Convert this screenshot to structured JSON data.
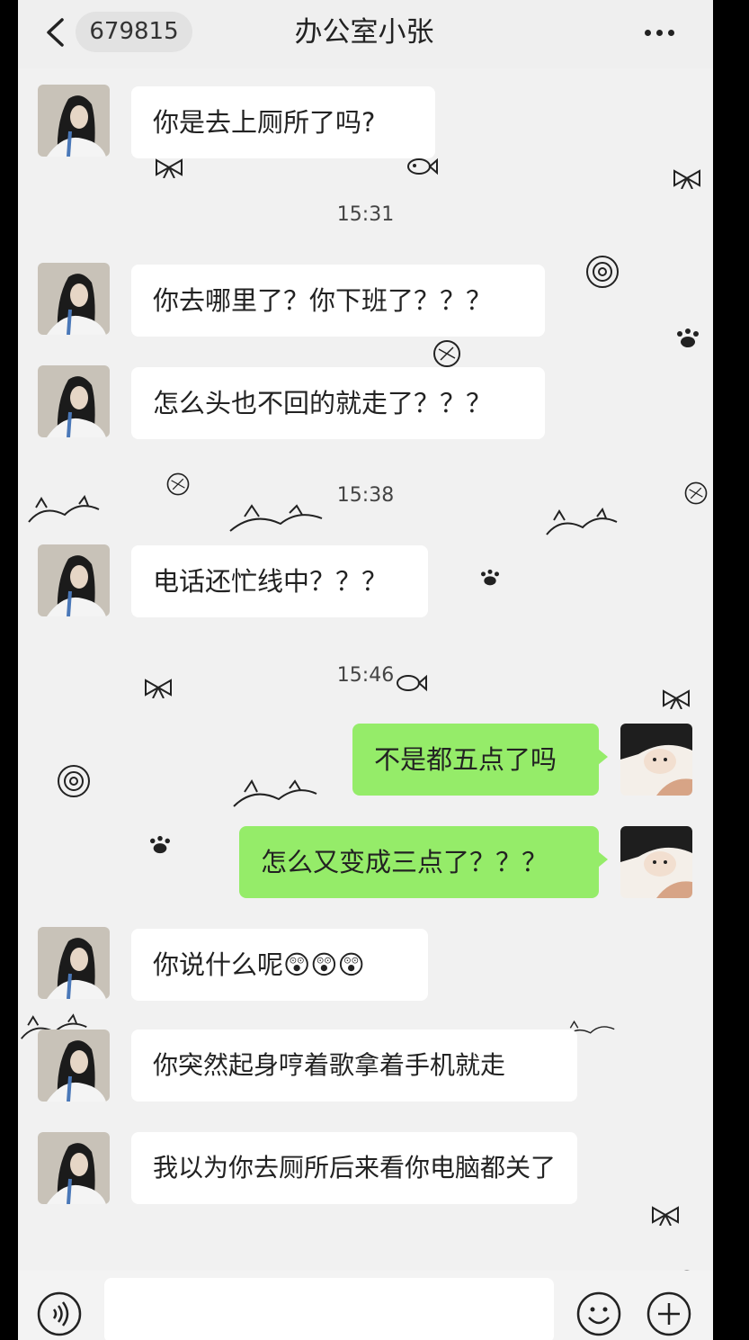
{
  "header": {
    "unread_count": "679815",
    "title": "办公室小张"
  },
  "messages": [
    {
      "text": "你是去上厕所了吗?"
    },
    {
      "text": "你去哪里了？你下班了？？？"
    },
    {
      "text": "怎么头也不回的就走了？？？"
    },
    {
      "text": "电话还忙线中？？？"
    },
    {
      "text": "不是都五点了吗"
    },
    {
      "text": "怎么又变成三点了？？？"
    },
    {
      "text": "你说什么呢😲😲😲"
    },
    {
      "text": "你突然起身哼着歌拿着手机就走"
    },
    {
      "text": "我以为你去厕所后来看你电脑都关了"
    }
  ],
  "timestamps": [
    "15:31",
    "15:38",
    "15:46"
  ],
  "colors": {
    "outgoing_bubble": "#95ec69",
    "incoming_bubble": "#ffffff",
    "background": "#f1f1f1"
  },
  "icons": {
    "back": "chevron-left-icon",
    "more": "more-dots-icon",
    "voice": "voice-icon",
    "emoji": "emoji-icon",
    "plus": "plus-icon"
  }
}
